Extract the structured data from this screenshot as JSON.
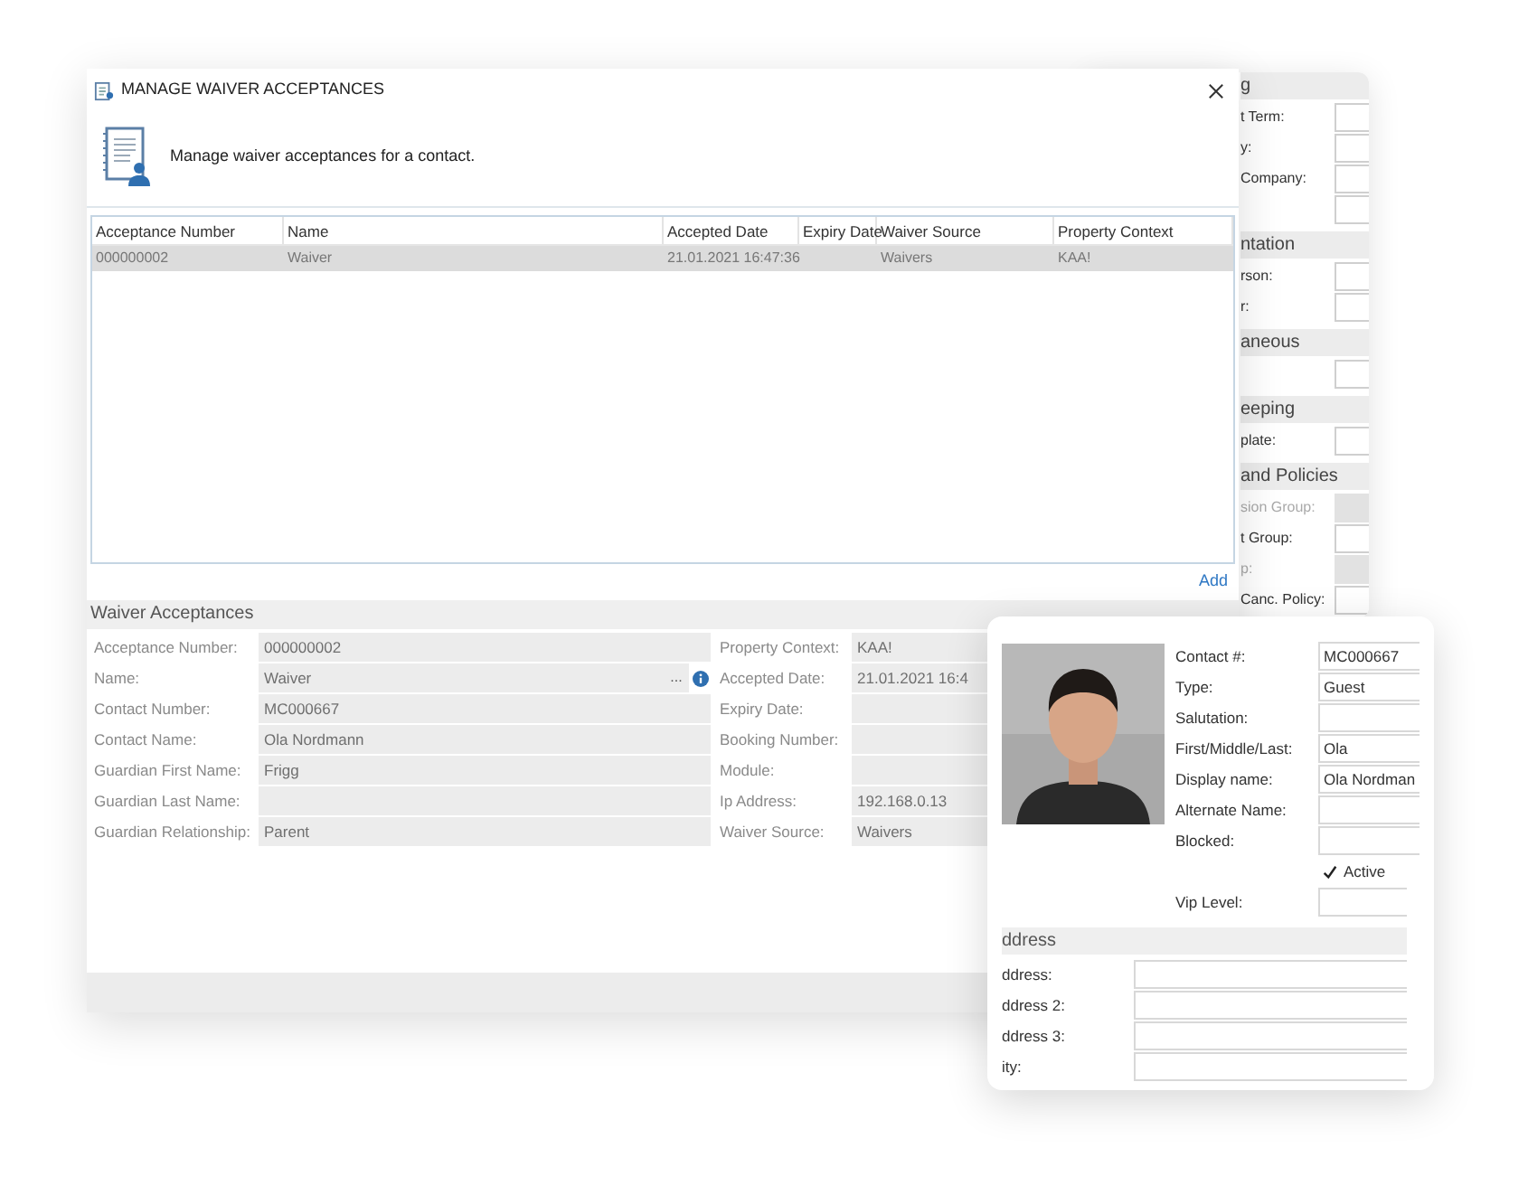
{
  "back_panel": {
    "sections": [
      {
        "title": "g",
        "fields": [
          {
            "label": "t Term:",
            "disabled": false
          },
          {
            "label": "y:",
            "disabled": false
          },
          {
            "label": "Company:",
            "disabled": false
          },
          {
            "disabled": false
          }
        ]
      },
      {
        "title": "ntation",
        "fields": [
          {
            "label": "rson:",
            "disabled": false
          },
          {
            "label": "r:",
            "disabled": false
          }
        ]
      },
      {
        "title": "aneous",
        "fields": [
          {
            "disabled": false
          }
        ]
      },
      {
        "title": "eeping",
        "fields": [
          {
            "label": "plate:",
            "disabled": false
          }
        ]
      },
      {
        "title": "and Policies",
        "fields": [
          {
            "label": "sion Group:",
            "disabled": true
          },
          {
            "label": "t Group:",
            "disabled": false
          },
          {
            "label": "p:",
            "disabled": true
          },
          {
            "label": "Canc. Policy:",
            "disabled": false
          }
        ]
      }
    ]
  },
  "dialog": {
    "title": "MANAGE WAIVER ACCEPTANCES",
    "description": "Manage waiver acceptances for a contact.",
    "table": {
      "columns": [
        "Acceptance Number",
        "Name",
        "Accepted Date",
        "Expiry Date",
        "Waiver Source",
        "Property Context"
      ],
      "rows": [
        {
          "cells": [
            "000000002",
            "Waiver",
            "21.01.2021 16:47:36",
            "",
            "Waivers",
            "KAA!"
          ],
          "selected": true
        }
      ]
    },
    "add_link": "Add",
    "section_title": "Waiver Acceptances",
    "left_fields": [
      {
        "label": "Acceptance Number:",
        "value": "000000002"
      },
      {
        "label": "Name:",
        "value": "Waiver",
        "button": "..."
      },
      {
        "label": "Contact Number:",
        "value": "MC000667"
      },
      {
        "label": "Contact Name:",
        "value": "Ola Nordmann"
      },
      {
        "label": "Guardian First Name:",
        "value": "Frigg"
      },
      {
        "label": "Guardian Last Name:"
      },
      {
        "label": "Guardian Relationship:",
        "value": "Parent"
      }
    ],
    "right_fields": [
      {
        "label": "Property Context:",
        "value": "KAA!"
      },
      {
        "label": "Accepted Date:",
        "value": "21.01.2021 16:4"
      },
      {
        "label": "Expiry Date:"
      },
      {
        "label": "Booking Number:"
      },
      {
        "label": "Module:"
      },
      {
        "label": "Ip Address:",
        "value": "192.168.0.13"
      },
      {
        "label": "Waiver Source:",
        "value": "Waivers"
      }
    ]
  },
  "contact_card": {
    "fields": [
      {
        "label": "Contact #:",
        "value": "MC000667"
      },
      {
        "label": "Type:",
        "value": "Guest"
      },
      {
        "label": "Salutation:"
      },
      {
        "label": "First/Middle/Last:",
        "value": "Ola"
      },
      {
        "label": "Display name:",
        "value": "Ola Nordman"
      },
      {
        "label": "Alternate Name:"
      },
      {
        "label": "Blocked:"
      }
    ],
    "active": {
      "label": "Active",
      "checked": true
    },
    "vip_level": {
      "label": "Vip Level:"
    },
    "address_title": "ddress",
    "address_fields": [
      {
        "label": "ddress:"
      },
      {
        "label": "ddress 2:"
      },
      {
        "label": "ddress 3:"
      },
      {
        "label": "ity:"
      }
    ]
  }
}
